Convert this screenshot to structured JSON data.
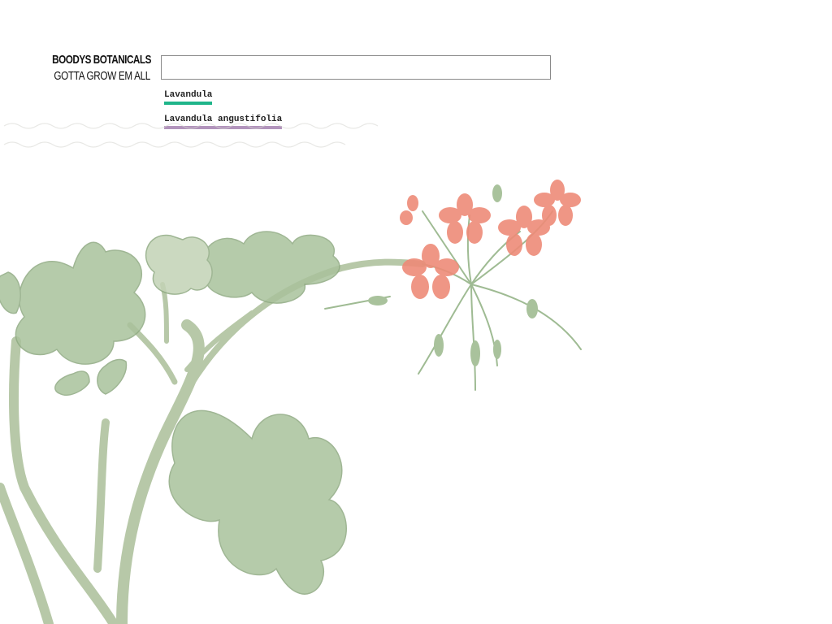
{
  "brand": {
    "title": "BOODYS BOTANICALS",
    "tagline": "GOTTA GROW EM ALL"
  },
  "search": {
    "value": "",
    "placeholder": ""
  },
  "suggestions": [
    {
      "label": "Lavandula",
      "color": "#1fb58a"
    },
    {
      "label": "Lavandula angustifolia",
      "color": "#b294bc"
    }
  ],
  "illustration": {
    "subject": "geranium-plant",
    "leaf_color": "#9fbb93",
    "flower_color": "#ee8b78"
  }
}
